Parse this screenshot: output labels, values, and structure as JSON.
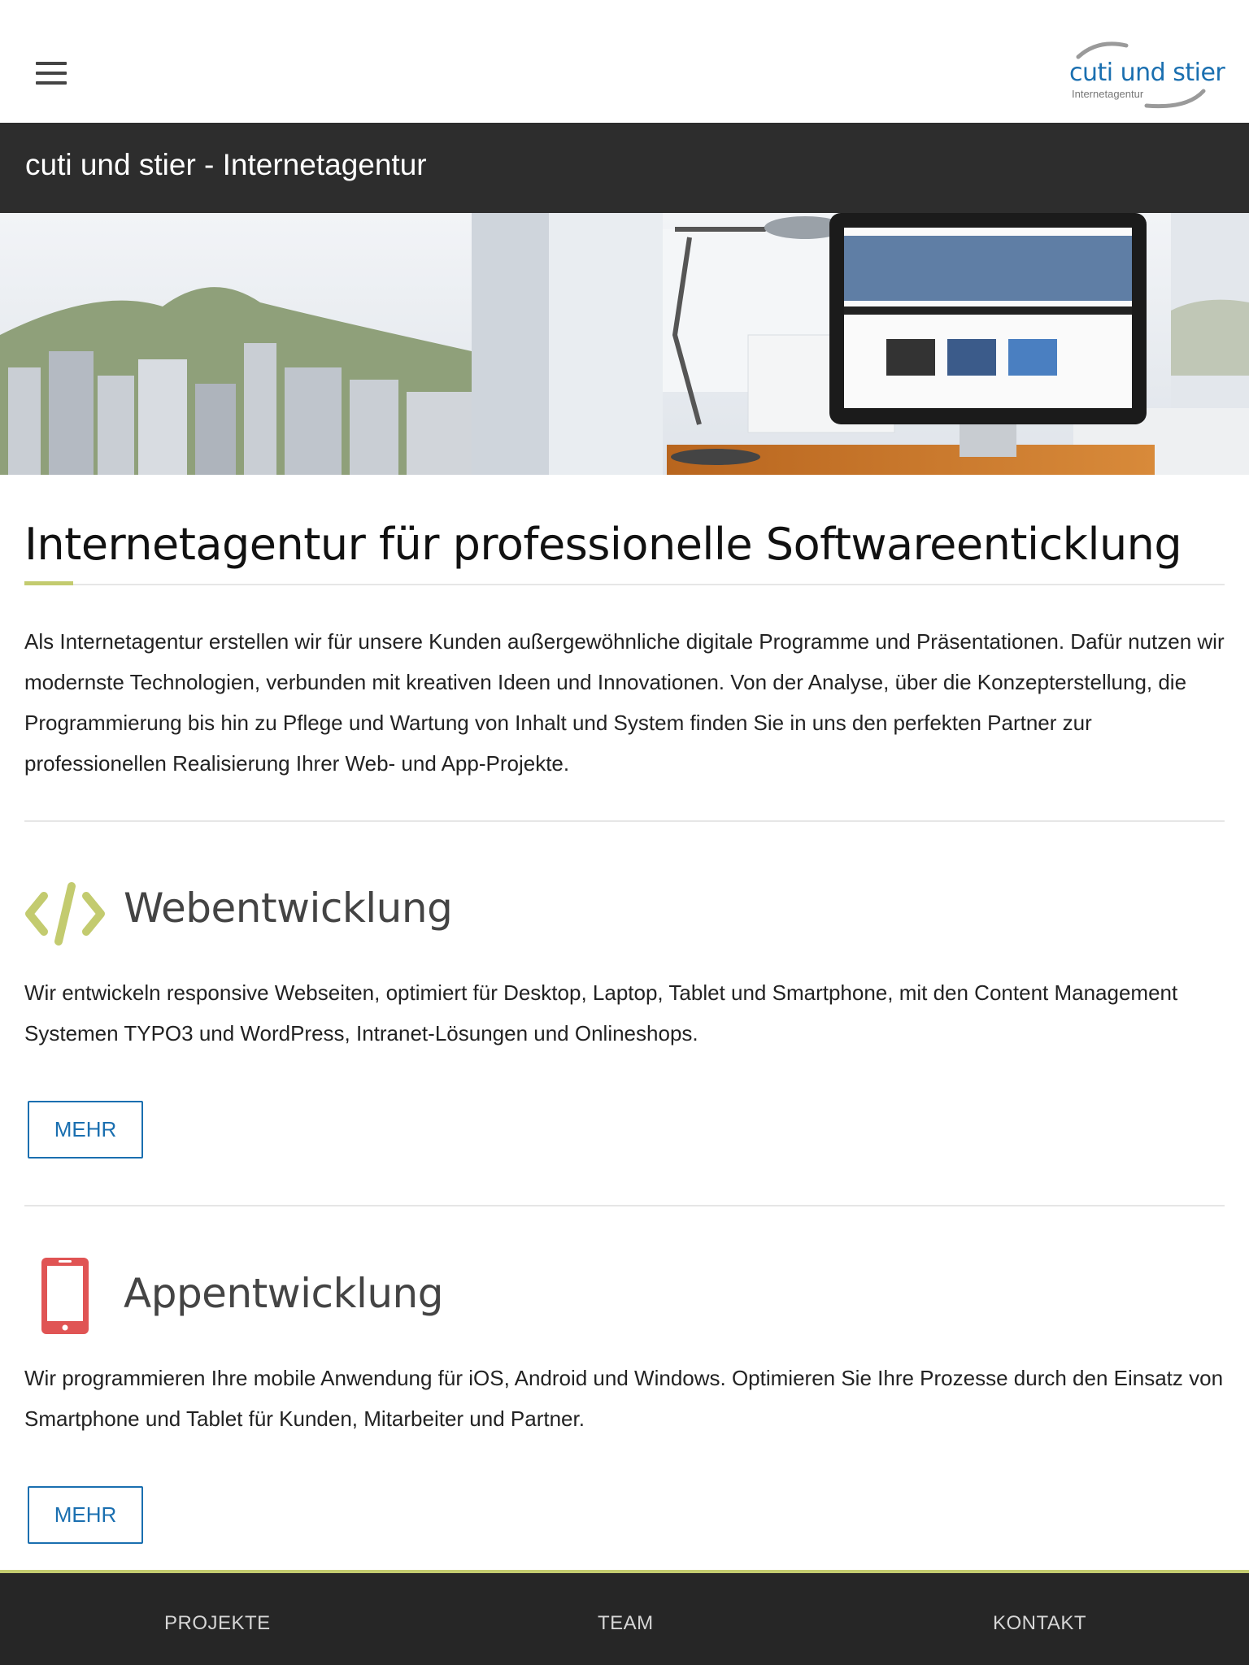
{
  "header": {
    "menu_icon": "hamburger-menu-icon",
    "logo": {
      "name": "cuti und stier",
      "subtitle": "Internetagentur",
      "color": "#1a6fb0"
    }
  },
  "titlebar": {
    "title": "cuti und stier - Internetagentur"
  },
  "hero": {
    "description_icon": "office-desk-monitor-city-view"
  },
  "intro": {
    "heading": "Internetagentur für professionelle Softwareenticklung",
    "text": "Als Internetagentur erstellen wir für unsere Kunden außergewöhnliche digitale Programme und Präsentationen. Dafür nutzen wir modernste Technologien, verbunden mit kreativen Ideen und Innovationen. Von der Analyse, über die Konzepterstellung, die Programmierung bis hin zu Pflege und Wartung von Inhalt und System finden Sie in uns den perfekten Partner zur professionellen Realisierung Ihrer Web- und App-Projekte."
  },
  "sections": [
    {
      "icon": "code-icon",
      "title": "Webentwicklung",
      "text": "Wir entwickeln responsive Webseiten, optimiert für Desktop, Laptop, Tablet und Smartphone, mit den Content Management Systemen TYPO3 und WordPress, Intranet-Lösungen und Onlineshops.",
      "button": "MEHR"
    },
    {
      "icon": "smartphone-icon",
      "title": "Appentwicklung",
      "text": "Wir programmieren Ihre mobile Anwendung für iOS, Android und Windows. Optimieren Sie Ihre Prozesse durch den Einsatz von Smartphone und Tablet für Kunden, Mitarbeiter und Partner.",
      "button": "MEHR"
    }
  ],
  "bottom_nav": {
    "items": [
      "PROJEKTE",
      "TEAM",
      "KONTAKT"
    ]
  },
  "colors": {
    "accent_green": "#c3cb6f",
    "link_blue": "#1a6fb0",
    "dark_bar": "#2d2d2d",
    "app_icon_red": "#e05454"
  }
}
